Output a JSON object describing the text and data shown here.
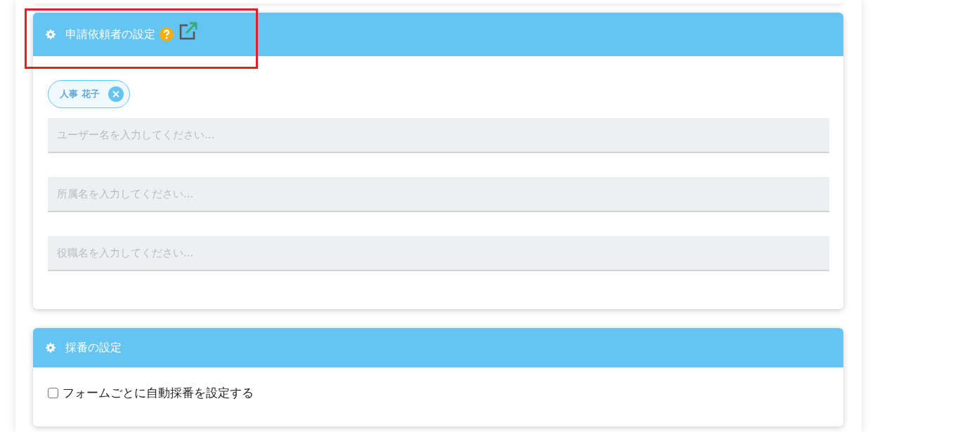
{
  "requester_section": {
    "title": "申請依頼者の設定",
    "selected_users": [
      {
        "label": "人事 花子"
      }
    ],
    "fields": [
      {
        "placeholder": "ユーザー名を入力してください..."
      },
      {
        "placeholder": "所属名を入力してください..."
      },
      {
        "placeholder": "役職名を入力してください..."
      }
    ]
  },
  "numbering_section": {
    "title": "採番の設定",
    "checkbox": {
      "label": "フォームごとに自動採番を設定する",
      "checked": false
    }
  }
}
